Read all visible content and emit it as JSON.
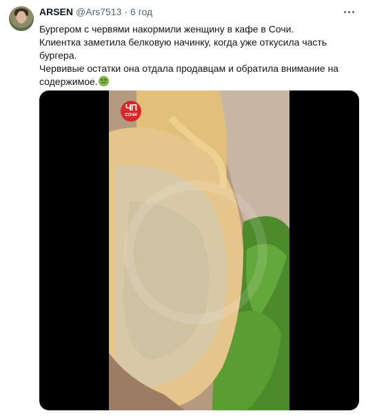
{
  "tweet": {
    "display_name": "ARSEN",
    "handle": "@Ars7513",
    "separator": "·",
    "time": "6 год",
    "text_lines": [
      "Бургером с червями накормили женщину в кафе в Сочи.",
      "Клиентка заметила белковую начинку, когда уже откусила часть",
      "бургера.",
      "Червивые остатки она отдала продавцам и обратила внимание на",
      "содержимое."
    ],
    "emoji": "nauseated-face-icon"
  },
  "media": {
    "logo_top": "ЧП",
    "logo_city": "СОЧИ"
  },
  "colors": {
    "text": "#0f1419",
    "secondary": "#536471",
    "media_bg": "#000000",
    "logo_red": "#d9262b"
  }
}
